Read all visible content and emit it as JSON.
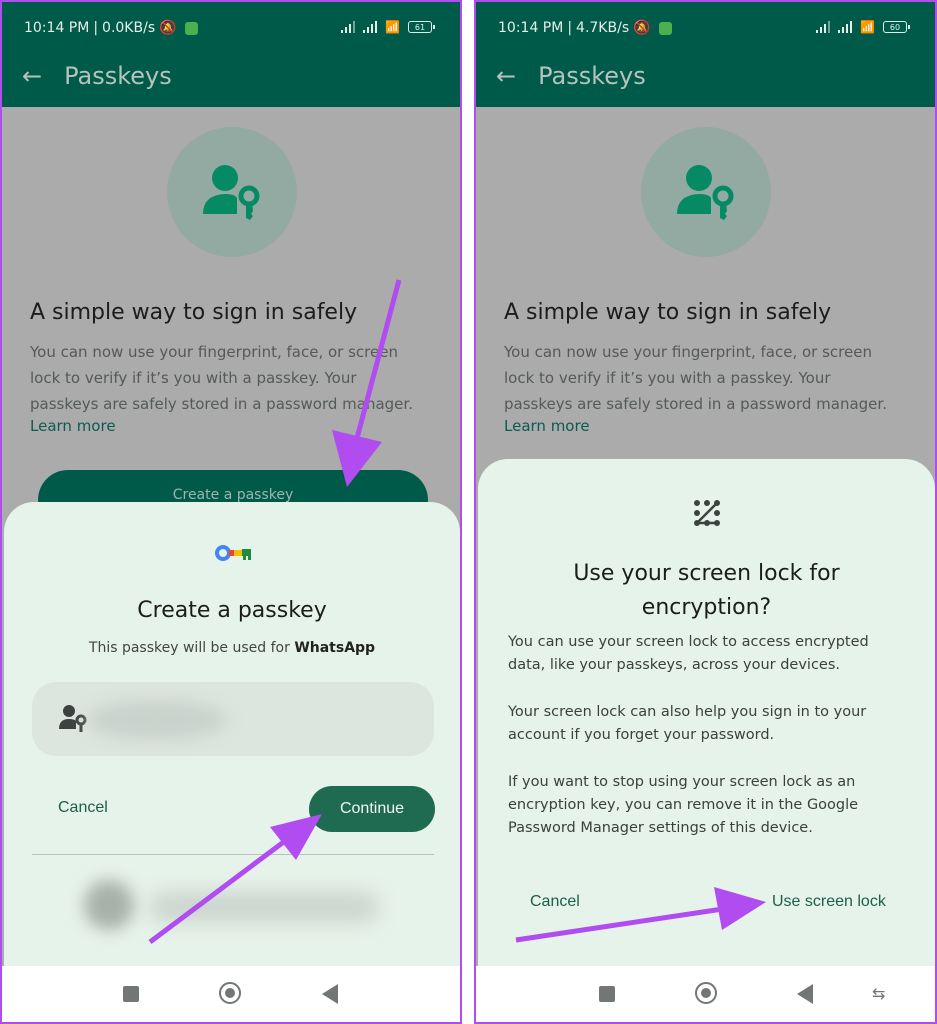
{
  "left": {
    "status": {
      "time": "10:14 PM",
      "speed": "0.0KB/s",
      "battery": "61"
    },
    "appbar": {
      "title": "Passkeys"
    },
    "background": {
      "heading": "A simple way to sign in safely",
      "description": "You can now use your fingerprint, face, or screen lock to verify if it’s you with a passkey. Your passkeys are safely stored in a password manager.",
      "learn_more": "Learn more",
      "create_button": "Create a passkey"
    },
    "sheet": {
      "title": "Create a passkey",
      "subtitle_prefix": "This passkey will be used for ",
      "subtitle_app": "WhatsApp",
      "cancel": "Cancel",
      "continue": "Continue"
    }
  },
  "right": {
    "status": {
      "time": "10:14 PM",
      "speed": "4.7KB/s",
      "battery": "60"
    },
    "appbar": {
      "title": "Passkeys"
    },
    "background": {
      "heading": "A simple way to sign in safely",
      "description": "You can now use your fingerprint, face, or screen lock to verify if it’s you with a passkey. Your passkeys are safely stored in a password manager.",
      "learn_more": "Learn more"
    },
    "sheet": {
      "title": "Use your screen lock for encryption?",
      "paragraphs": [
        "You can use your screen lock to access encrypted data, like your passkeys, across your devices.",
        "Your screen lock can also help you sign in to your account if you forget your password.",
        "If you want to stop using your screen lock as an encryption key, you can remove it in the Google Password Manager settings of this device."
      ],
      "cancel": "Cancel",
      "confirm": "Use screen lock"
    }
  },
  "colors": {
    "appbar": "#005a4a",
    "sheet": "#e6f3ea",
    "accent": "#1f6b52",
    "annotation": "#b04cf0"
  }
}
